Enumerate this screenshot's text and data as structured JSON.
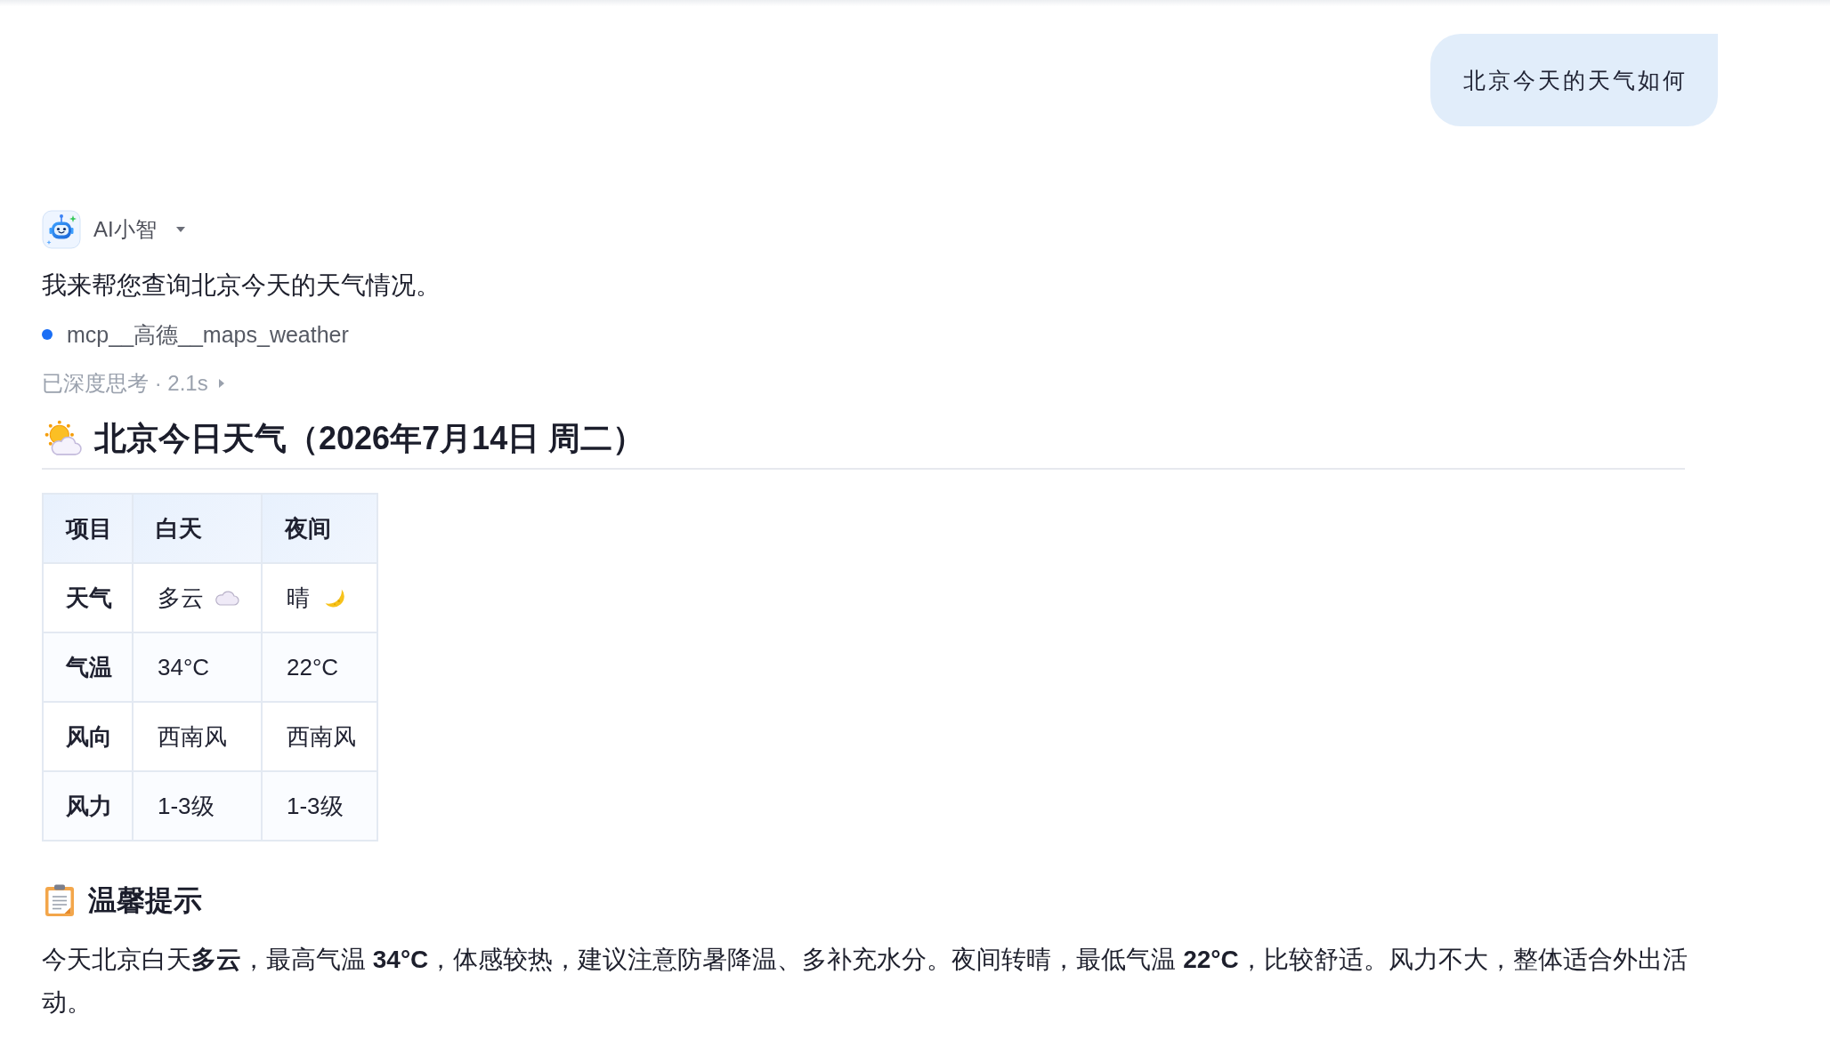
{
  "user_message": "北京今天的天气如何",
  "assistant": {
    "name": "AI小智",
    "message": "我来帮您查询北京今天的天气情况。",
    "tool_call": "mcp__高德__maps_weather",
    "thinking": {
      "label": "已深度思考 · 2.1s",
      "expanded": false
    }
  },
  "weather_report": {
    "title": "北京今日天气（2026年7月14日 周二）",
    "table": {
      "columns": [
        "项目",
        "白天",
        "夜间"
      ],
      "rows": [
        {
          "cells": [
            {
              "text": "天气",
              "kind": "header"
            },
            {
              "text": "多云",
              "kind": "cloud"
            },
            {
              "text": "晴",
              "kind": "moon"
            }
          ]
        },
        {
          "cells": [
            {
              "text": "气温",
              "kind": "header"
            },
            {
              "text": "34°C",
              "kind": "plain"
            },
            {
              "text": "22°C",
              "kind": "plain"
            }
          ]
        },
        {
          "cells": [
            {
              "text": "风向",
              "kind": "header"
            },
            {
              "text": "西南风",
              "kind": "plain"
            },
            {
              "text": "西南风",
              "kind": "plain"
            }
          ]
        },
        {
          "cells": [
            {
              "text": "风力",
              "kind": "header"
            },
            {
              "text": "1-3级",
              "kind": "plain"
            },
            {
              "text": "1-3级",
              "kind": "plain"
            }
          ]
        }
      ]
    },
    "tips": {
      "heading": "温馨提示",
      "text": "今天北京白天**多云**，最高气温 **34°C**，体感较热，建议注意防暑降温、多补充水分。夜间转晴，最低气温 **22°C**，比较舒适。风力不大，整体适合外出活动。"
    }
  }
}
